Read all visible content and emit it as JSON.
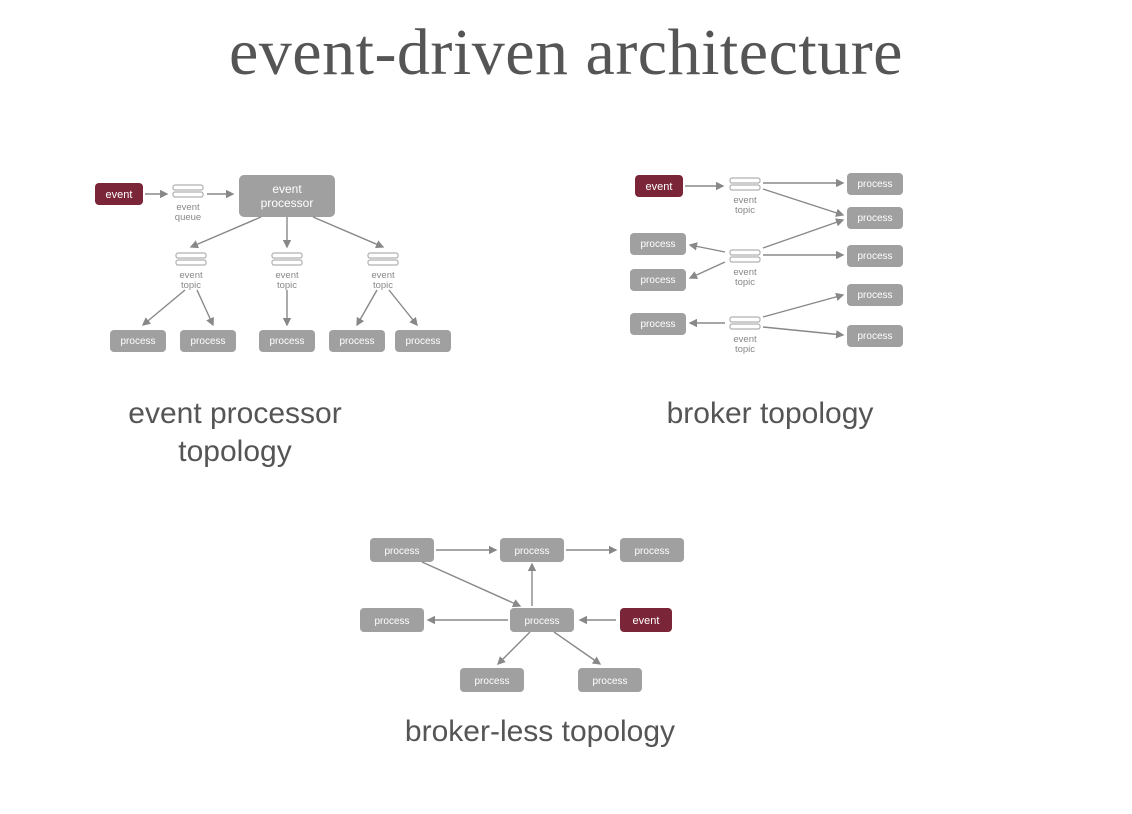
{
  "title": "event-driven architecture",
  "captions": {
    "topLeft": "event processor topology",
    "topRight": "broker topology",
    "bottom": "broker-less topology"
  },
  "labels": {
    "event": "event",
    "eventProcessor": "event processor",
    "process": "process",
    "eventQueue": "event queue",
    "eventTopic": "event topic"
  },
  "colors": {
    "event": "#7a2638",
    "node": "#a0a0a0",
    "text": "#555555"
  }
}
